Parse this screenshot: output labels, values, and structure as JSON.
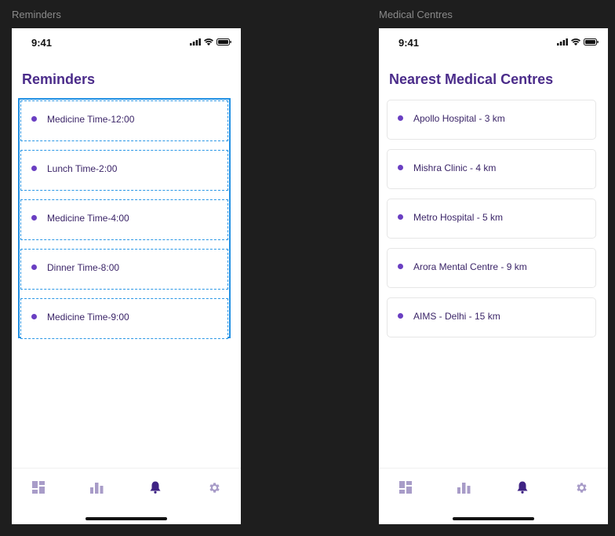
{
  "frames": [
    {
      "label": "Reminders",
      "time": "9:41",
      "title": "Reminders",
      "items": [
        {
          "label": "Medicine Time-12:00"
        },
        {
          "label": "Lunch Time-2:00"
        },
        {
          "label": "Medicine Time-4:00"
        },
        {
          "label": "Dinner Time-8:00"
        },
        {
          "label": "Medicine Time-9:00"
        }
      ]
    },
    {
      "label": "Medical Centres",
      "time": "9:41",
      "title": "Nearest Medical Centres",
      "items": [
        {
          "label": "Apollo Hospital - 3 km"
        },
        {
          "label": "Mishra Clinic - 4 km"
        },
        {
          "label": "Metro Hospital - 5 km"
        },
        {
          "label": "Arora Mental Centre - 9 km"
        },
        {
          "label": "AIMS - Delhi - 15 km"
        }
      ]
    }
  ],
  "tabs": [
    {
      "icon": "dashboard-icon",
      "active": false
    },
    {
      "icon": "bar-chart-icon",
      "active": false
    },
    {
      "icon": "bell-icon",
      "active": true
    },
    {
      "icon": "gear-icon",
      "active": false
    }
  ],
  "colors": {
    "accent": "#4b2c8a",
    "bullet": "#6a3fc2",
    "tab_inactive": "#a89cc8",
    "selection": "#1f8fe3"
  }
}
